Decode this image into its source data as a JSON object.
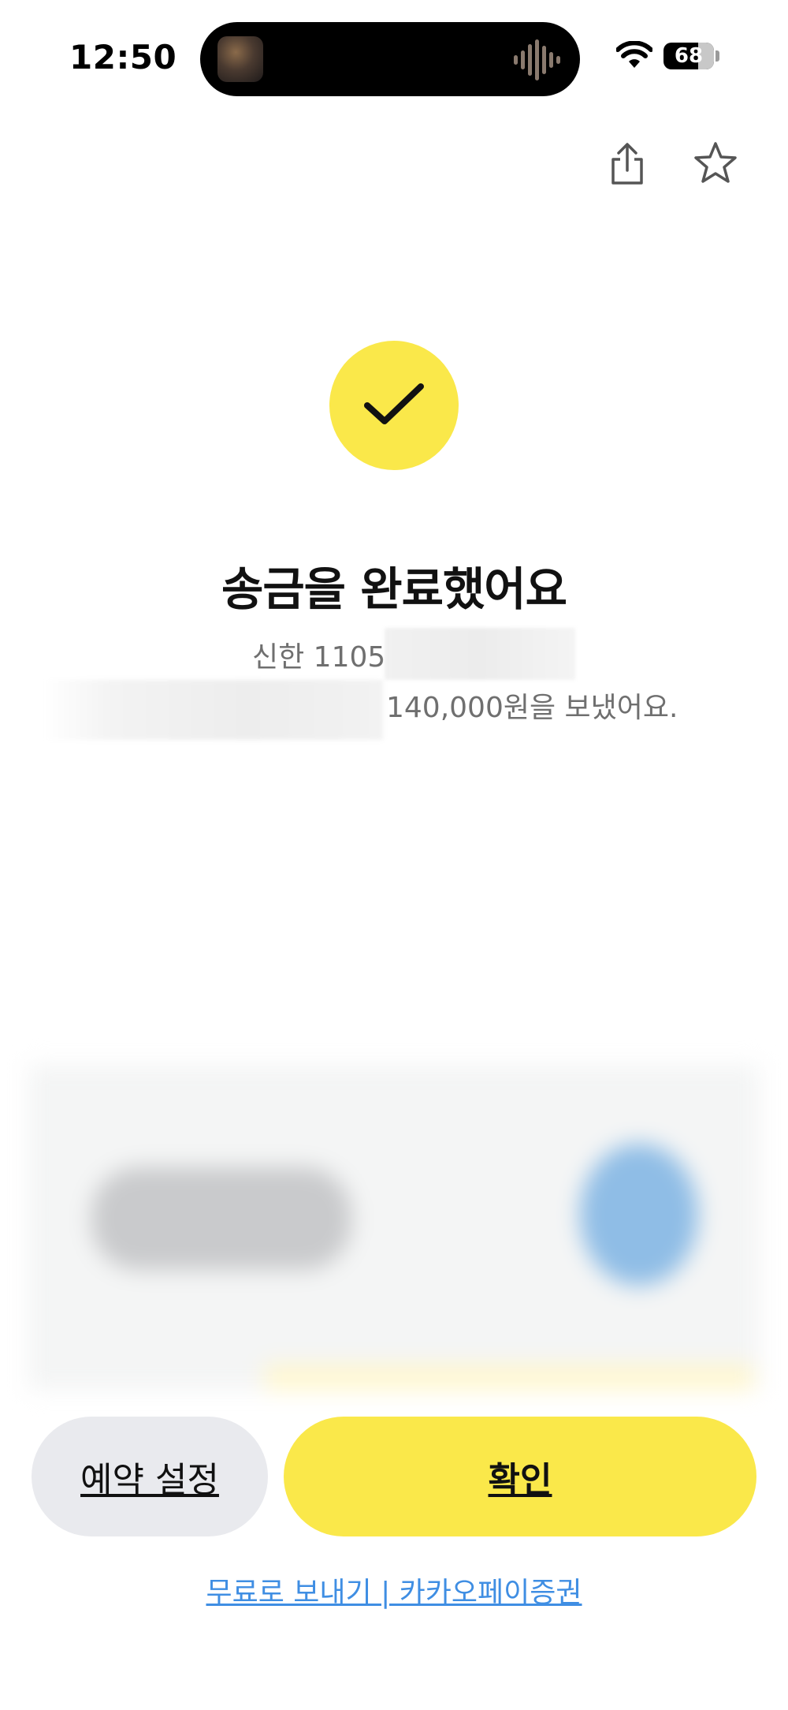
{
  "status_bar": {
    "time": "12:50",
    "battery": "68",
    "icons": [
      "album-art-icon",
      "audio-wave-icon",
      "wifi-icon",
      "battery-icon"
    ]
  },
  "header": {
    "icons": [
      "share-icon",
      "star-icon"
    ]
  },
  "result": {
    "icon": "check-icon",
    "title": "송금을 완료했어요",
    "line1_prefix": "신한 1105",
    "line2_suffix": "140,000원을 보냈어요."
  },
  "actions": {
    "schedule_label": "예약 설정",
    "confirm_label": "확인"
  },
  "footer": {
    "link_label": "무료로 보내기 | 카카오페이증권"
  },
  "colors": {
    "accent_yellow": "#fae84a",
    "secondary_button": "#e9eaee",
    "link_blue": "#3f8ee3",
    "muted_text": "#6f6f6f"
  }
}
